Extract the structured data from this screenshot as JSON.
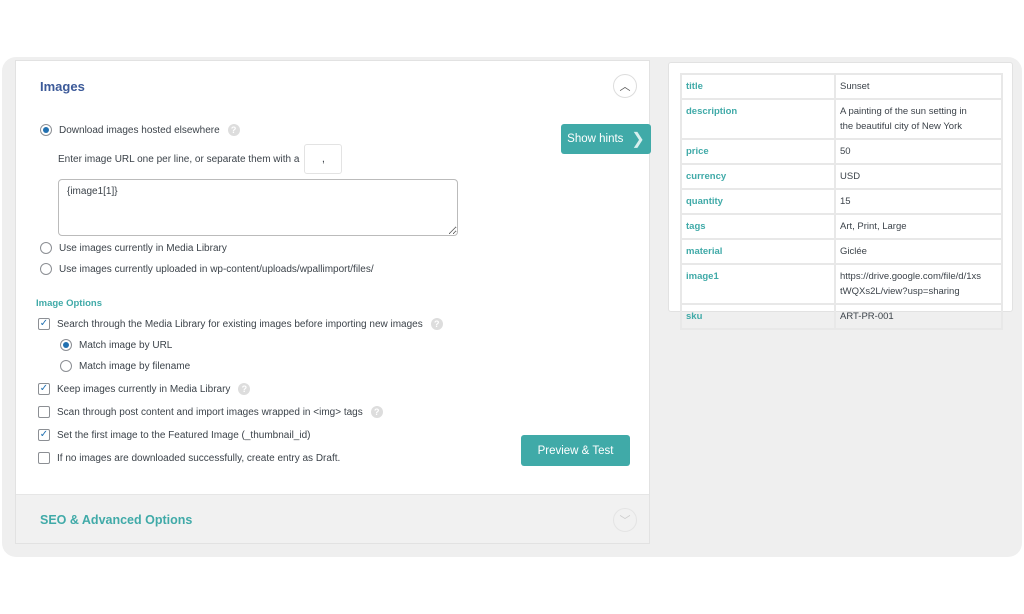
{
  "images_section": {
    "title": "Images",
    "download_option": "Download images hosted elsewhere",
    "separator_prompt": "Enter image URL one per line, or separate them with a",
    "separator_value": ",",
    "urls_value": "{image1[1]}",
    "media_library_option": "Use images currently in Media Library",
    "uploaded_option": "Use images currently uploaded in wp-content/uploads/wpallimport/files/",
    "selected_source": "download",
    "show_hints_label": "Show hints",
    "image_options_title": "Image Options",
    "options": [
      {
        "label": "Search through the Media Library for existing images before importing new images",
        "checked": true,
        "help": true
      },
      {
        "label": "Keep images currently in Media Library",
        "checked": true,
        "help": true
      },
      {
        "label": "Scan through post content and import images wrapped in <img> tags",
        "checked": false,
        "help": true
      },
      {
        "label": "Set the first image to the Featured Image (_thumbnail_id)",
        "checked": true,
        "help": false
      },
      {
        "label": "If no images are downloaded successfully, create entry as Draft.",
        "checked": false,
        "help": false
      }
    ],
    "match_by_url": "Match image by URL",
    "match_by_filename": "Match image by filename",
    "match_selected": "url",
    "preview_button": "Preview & Test",
    "help_glyph": "?"
  },
  "seo_section": {
    "title": "SEO & Advanced Options"
  },
  "record": [
    {
      "key": "title",
      "value": "Sunset"
    },
    {
      "key": "description",
      "value": "A painting of the sun setting in\nthe beautiful city of New York"
    },
    {
      "key": "price",
      "value": "50"
    },
    {
      "key": "currency",
      "value": "USD"
    },
    {
      "key": "quantity",
      "value": "15"
    },
    {
      "key": "tags",
      "value": "Art, Print, Large"
    },
    {
      "key": "material",
      "value": "Giclée"
    },
    {
      "key": "image1",
      "value": "https://drive.google.com/file/d/1xs\ntWQXs2L/view?usp=sharing"
    },
    {
      "key": "sku",
      "value": "ART-PR-001"
    }
  ],
  "colors": {
    "accent": "#40aaa8",
    "heading": "#3c5a99",
    "radio": "#2271b1"
  }
}
